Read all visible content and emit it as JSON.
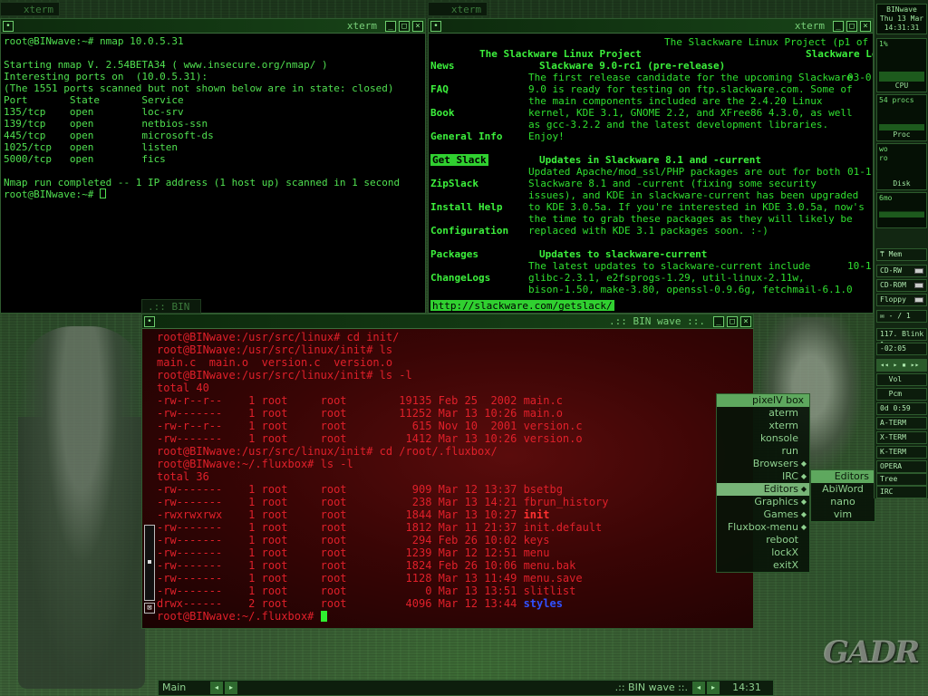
{
  "tabs": {
    "left": "xterm",
    "right": "xterm",
    "bin": ".:: BIN wa"
  },
  "nmap_window": {
    "title": "xterm",
    "lines": [
      "root@BINwave:~# nmap 10.0.5.31",
      "",
      "Starting nmap V. 2.54BETA34 ( www.insecure.org/nmap/ )",
      "Interesting ports on  (10.0.5.31):",
      "(The 1551 ports scanned but not shown below are in state: closed)",
      "Port       State       Service",
      "135/tcp    open        loc-srv",
      "139/tcp    open        netbios-ssn",
      "445/tcp    open        microsoft-ds",
      "1025/tcp   open        listen",
      "5000/tcp   open        fics",
      "",
      "Nmap run completed -- 1 IP address (1 host up) scanned in 1 second",
      "root@BINwave:~# "
    ]
  },
  "lynx_window": {
    "title": "xterm",
    "page_title": "The Slackware Linux Project (p1 of 5)",
    "header": "The Slackware Linux Project",
    "header_right": "Slackware Lo",
    "nav": [
      "News",
      "FAQ",
      "Book",
      "General Info",
      "Get Slack",
      "ZipSlack",
      "Install Help",
      "Configuration",
      "Packages",
      "ChangeLogs"
    ],
    "headline1": "Slackware 9.0-rc1 (pre-release)",
    "date1": "03-0",
    "body1": [
      "The first release candidate for the upcoming Slackware",
      "9.0 is ready for testing on ftp.slackware.com. Some of",
      "the main components included are the 2.4.20 Linux",
      "kernel, KDE 3.1, GNOME 2.2, and XFree86 4.3.0, as well",
      "as gcc-3.2.2 and the latest development libraries.",
      "Enjoy!"
    ],
    "headline2": "Updates in Slackware 8.1 and -current",
    "date2": "01-1",
    "body2": [
      "Updated Apache/mod_ssl/PHP packages are out for both",
      "Slackware 8.1 and -current (fixing some security",
      "issues), and KDE in slackware-current has been upgraded",
      "to KDE 3.0.5a. If you're interested in KDE 3.0.5a, now's",
      "the time to grab these packages as they will likely be",
      "replaced with KDE 3.1 packages soon. :-)"
    ],
    "headline3": "Updates to slackware-current",
    "date3": "10-1",
    "body3": [
      "The latest updates to slackware-current include",
      "glibc-2.3.1, e2fsprogs-1.29, util-linux-2.11w,",
      "bison-1.50, make-3.80, openssl-0.9.6g, fetchmail-6.1.0"
    ],
    "status_url": "http://slackware.com/getslack/"
  },
  "red_window": {
    "title": ".:: BIN wave ::.",
    "lines": [
      {
        "t": "root@BINwave:/usr/src/linux# cd init/"
      },
      {
        "t": "root@BINwave:/usr/src/linux/init# ls"
      },
      {
        "t": "main.c  main.o  version.c  version.o"
      },
      {
        "t": "root@BINwave:/usr/src/linux/init# ls -l"
      },
      {
        "t": "total 40"
      },
      {
        "t": "-rw-r--r--    1 root     root        19135 Feb 25  2002 main.c"
      },
      {
        "t": "-rw-------    1 root     root        11252 Mar 13 10:26 main.o"
      },
      {
        "t": "-rw-r--r--    1 root     root          615 Nov 10  2001 version.c"
      },
      {
        "t": "-rw-------    1 root     root         1412 Mar 13 10:26 version.o"
      },
      {
        "t": "root@BINwave:/usr/src/linux/init# cd /root/.fluxbox/"
      },
      {
        "t": "root@BINwave:~/.fluxbox# ls -l"
      },
      {
        "t": "total 36"
      },
      {
        "t": "-rw-------    1 root     root          909 Mar 12 13:37 bsetbg"
      },
      {
        "t": "-rw-------    1 root     root          238 Mar 13 14:21 fbrun_history"
      },
      {
        "t": "-rwxrwxrwx    1 root     root         1844 Mar 13 10:27 ",
        "b": "init"
      },
      {
        "t": "-rw-------    1 root     root         1812 Mar 11 21:37 init.default"
      },
      {
        "t": "-rw-------    1 root     root          294 Feb 26 10:02 keys"
      },
      {
        "t": "-rw-------    1 root     root         1239 Mar 12 12:51 menu"
      },
      {
        "t": "-rw-------    1 root     root         1824 Feb 26 10:06 menu.bak"
      },
      {
        "t": "-rw-------    1 root     root         1128 Mar 13 11:49 menu.save"
      },
      {
        "t": "-rw-------    1 root     root            0 Mar 13 13:51 slitlist"
      },
      {
        "t": "drwx------    2 root     root         4096 Mar 12 13:44 ",
        "d": "styles"
      },
      {
        "t": "root@BINwave:~/.fluxbox# "
      }
    ]
  },
  "menu": {
    "title": "pixelV box",
    "items": [
      {
        "label": "aterm"
      },
      {
        "label": "xterm"
      },
      {
        "label": "konsole"
      },
      {
        "label": "run"
      },
      {
        "label": "Browsers",
        "sub": true
      },
      {
        "label": "IRC",
        "sub": true
      },
      {
        "label": "Editors",
        "sub": true,
        "selected": true
      },
      {
        "label": "Graphics",
        "sub": true
      },
      {
        "label": "Games",
        "sub": true
      },
      {
        "label": "Fluxbox-menu",
        "sub": true
      },
      {
        "label": "reboot"
      },
      {
        "label": "lockX"
      },
      {
        "label": "exitX"
      }
    ],
    "submenu_title": "Editors",
    "submenu": [
      "AbiWord",
      "nano",
      "vim"
    ]
  },
  "slit": {
    "title": "BINwave",
    "date": "Thu 13 Mar",
    "time": "14:31:31",
    "cpu_pct": "1%",
    "cpu_label": "CPU",
    "procs": "54 procs",
    "proc_label": "Proc",
    "disk_io": [
      "wo",
      "ro"
    ],
    "disk_label": "Disk",
    "mem_top": "6mo",
    "mem_label": "Mem",
    "drives": [
      "CD-RW",
      "CD-ROM",
      "Floppy"
    ],
    "mail": "- / 1",
    "blink": "117. Blink 1",
    "time_small": "-02:05",
    "vol": "Vol",
    "pcm": "Pcm",
    "od": "0d 0:59",
    "launchers": [
      "A-TERM",
      "X-TERM",
      "K-TERM",
      "OPERA",
      "Tree window",
      "IRC"
    ]
  },
  "toolbar": {
    "workspace": "Main box",
    "window": ".:: BIN wave ::.",
    "clock": "14:31"
  }
}
